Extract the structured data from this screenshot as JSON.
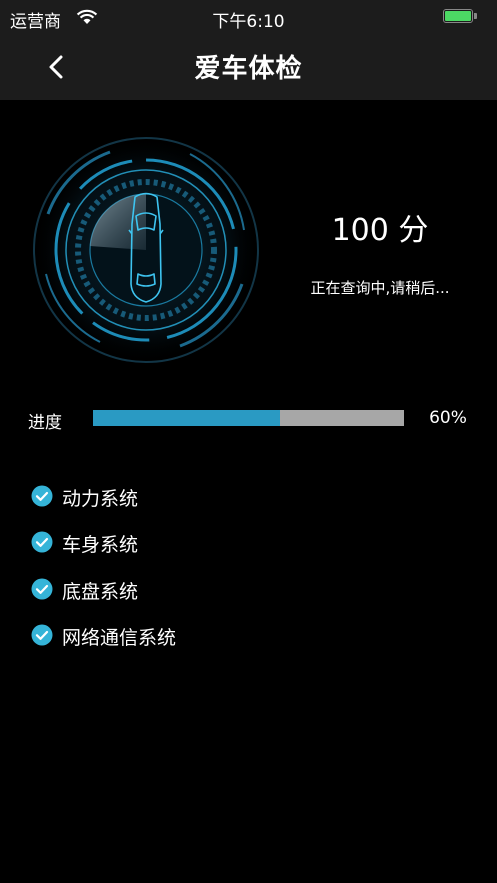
{
  "status_bar": {
    "carrier": "运营商",
    "time": "下午6:10"
  },
  "nav": {
    "title": "爱车体检",
    "back_icon": "chevron-left-icon"
  },
  "result": {
    "score": "100 分",
    "status": "正在查询中,请稍后..."
  },
  "progress": {
    "label": "进度",
    "value_text": "60%",
    "fraction": 0.6
  },
  "checklist": [
    {
      "label": "动力系统",
      "icon": "check-circle-icon"
    },
    {
      "label": "车身系统",
      "icon": "check-circle-icon"
    },
    {
      "label": "底盘系统",
      "icon": "check-circle-icon"
    },
    {
      "label": "网络通信系统",
      "icon": "check-circle-icon"
    }
  ],
  "colors": {
    "accent": "#2a9ac3",
    "check": "#35b4d8",
    "track": "#a7a7a7",
    "battery": "#4cd964"
  }
}
